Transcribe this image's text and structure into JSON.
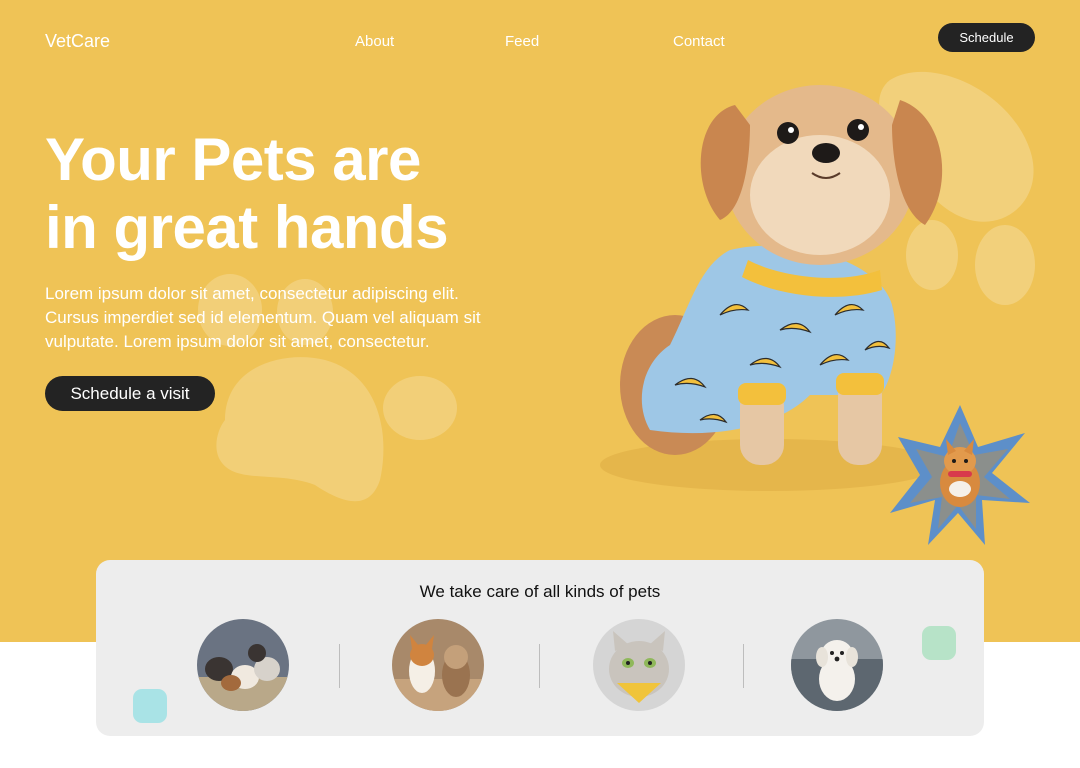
{
  "nav": {
    "logo": "VetCare",
    "links": [
      "About",
      "Feed",
      "Contact"
    ],
    "schedule_label": "Schedule"
  },
  "hero": {
    "headline_line1": "Your Pets are",
    "headline_line2": "in great hands",
    "description": "Lorem ipsum dolor sit amet, consectetur adipiscing elit. Cursus imperdiet sed id elementum. Quam vel aliquam sit vulputate. Lorem ipsum dolor sit amet, consectetur.",
    "cta_label": "Schedule  a visit"
  },
  "pets": {
    "title": "We take care of all kinds of pets",
    "items": [
      "puppies-photo",
      "dogs-photo",
      "cat-photo",
      "poodle-photo"
    ]
  },
  "colors": {
    "hero_bg": "#efc356",
    "button_dark": "#232323",
    "card_bg": "#ededed",
    "accent_pink": "#f3c4cb",
    "accent_teal": "#a9e3e6",
    "accent_green": "#b7e3c8"
  }
}
